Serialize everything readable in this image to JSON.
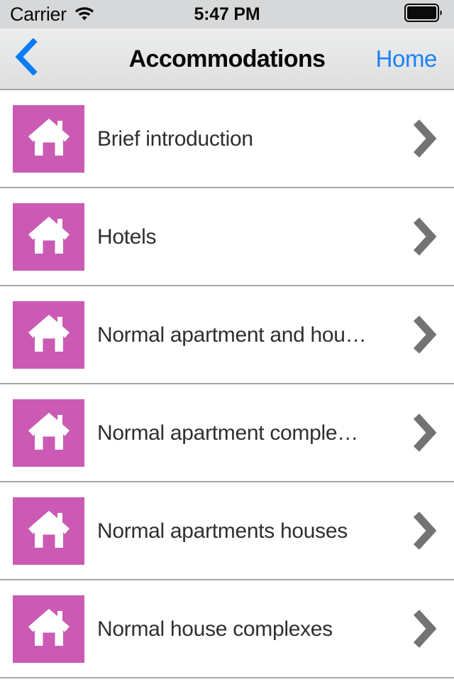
{
  "status_bar": {
    "carrier": "Carrier",
    "wifi_icon": "wifi-icon",
    "time": "5:47 PM",
    "battery_icon": "battery-full-icon"
  },
  "nav_bar": {
    "back_icon": "chevron-left-icon",
    "title": "Accommodations",
    "right_button_label": "Home"
  },
  "theme": {
    "tile_color": "#cb5ab4",
    "accent_blue": "#1a82f7",
    "separator": "#a7a7a9",
    "label_color": "#2f2f2f",
    "status_bg": "#d7d8da",
    "nav_bg": "#e6e7e8"
  },
  "list": {
    "rows": [
      {
        "label": "Brief introduction",
        "icon": "house-icon",
        "chevron": "chevron-right-icon"
      },
      {
        "label": "Hotels",
        "icon": "house-icon",
        "chevron": "chevron-right-icon"
      },
      {
        "label": "Normal apartment and hou…",
        "icon": "house-icon",
        "chevron": "chevron-right-icon"
      },
      {
        "label": "Normal apartment comple…",
        "icon": "house-icon",
        "chevron": "chevron-right-icon"
      },
      {
        "label": "Normal apartments houses",
        "icon": "house-icon",
        "chevron": "chevron-right-icon"
      },
      {
        "label": "Normal house complexes",
        "icon": "house-icon",
        "chevron": "chevron-right-icon"
      }
    ]
  }
}
